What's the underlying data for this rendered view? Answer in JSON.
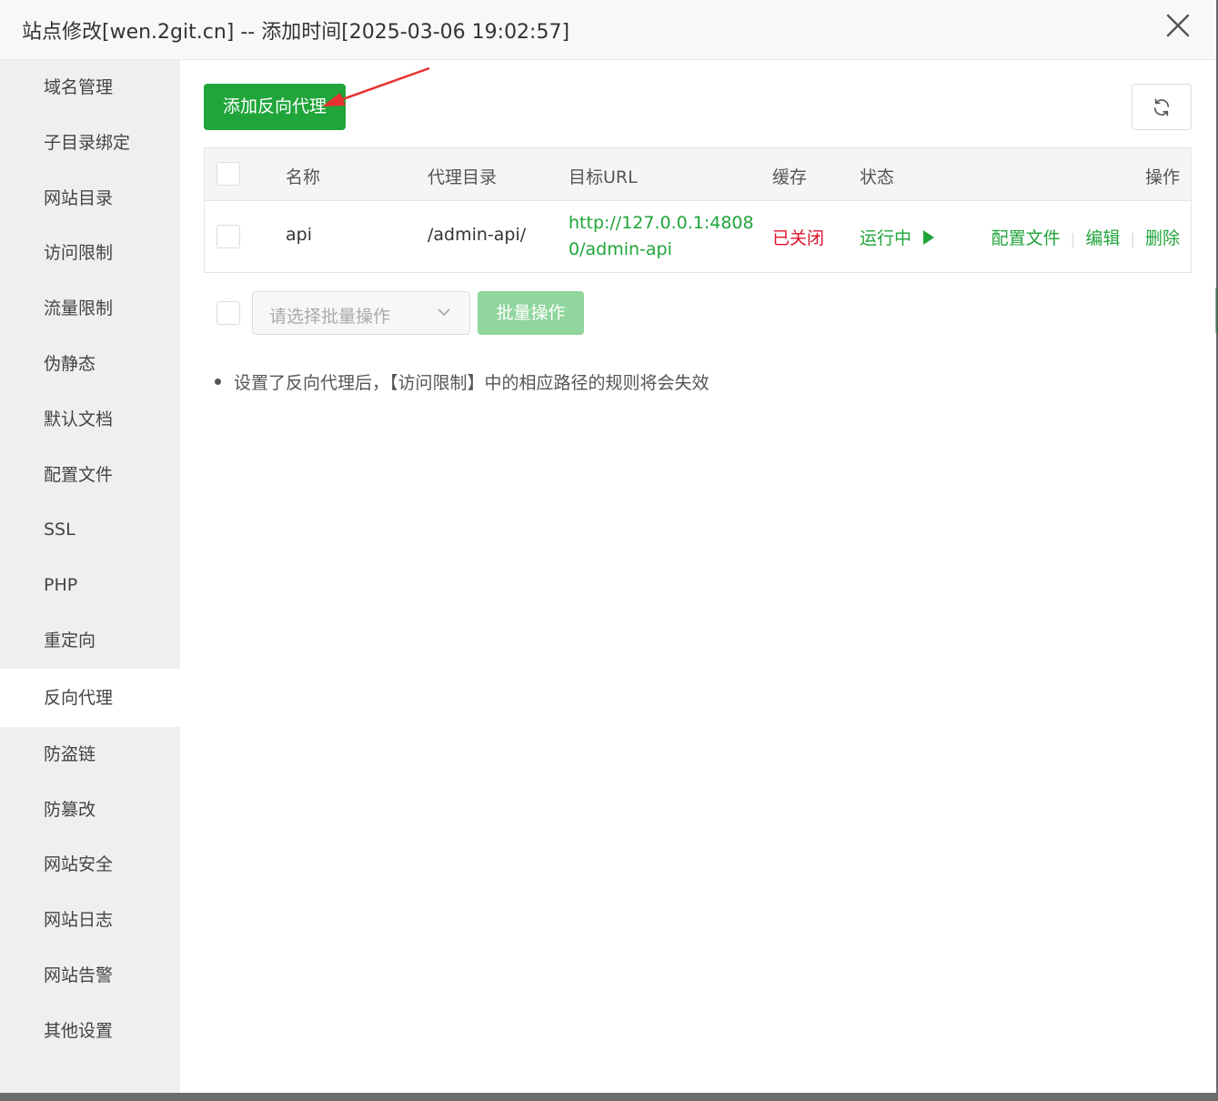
{
  "dialog": {
    "title": "站点修改[wen.2git.cn] -- 添加时间[2025-03-06 19:02:57]"
  },
  "sidebar": {
    "items": [
      {
        "label": "域名管理"
      },
      {
        "label": "子目录绑定"
      },
      {
        "label": "网站目录"
      },
      {
        "label": "访问限制"
      },
      {
        "label": "流量限制"
      },
      {
        "label": "伪静态"
      },
      {
        "label": "默认文档"
      },
      {
        "label": "配置文件"
      },
      {
        "label": "SSL"
      },
      {
        "label": "PHP"
      },
      {
        "label": "重定向"
      },
      {
        "label": "反向代理",
        "active": true
      },
      {
        "label": "防盗链"
      },
      {
        "label": "防篡改"
      },
      {
        "label": "网站安全"
      },
      {
        "label": "网站日志"
      },
      {
        "label": "网站告警"
      },
      {
        "label": "其他设置"
      }
    ]
  },
  "toolbar": {
    "add_label": "添加反向代理",
    "refresh_icon": "refresh-icon"
  },
  "table": {
    "headers": {
      "name": "名称",
      "dir": "代理目录",
      "url": "目标URL",
      "cache": "缓存",
      "status": "状态",
      "ops": "操作"
    },
    "rows": [
      {
        "name": "api",
        "dir": "/admin-api/",
        "url_line1": "http://127.0.0.1:4808",
        "url_line2": "0/admin-api",
        "cache": "已关闭",
        "status": "运行中",
        "op_config": "配置文件",
        "op_edit": "编辑",
        "op_delete": "删除"
      }
    ]
  },
  "batch": {
    "placeholder": "请选择批量操作",
    "button": "批量操作"
  },
  "tips": [
    "设置了反向代理后，【访问限制】中的相应路径的规则将会失效"
  ],
  "colors": {
    "primary": "#20a53a",
    "danger": "#e0112b",
    "annotation_arrow": "#e8322f"
  }
}
